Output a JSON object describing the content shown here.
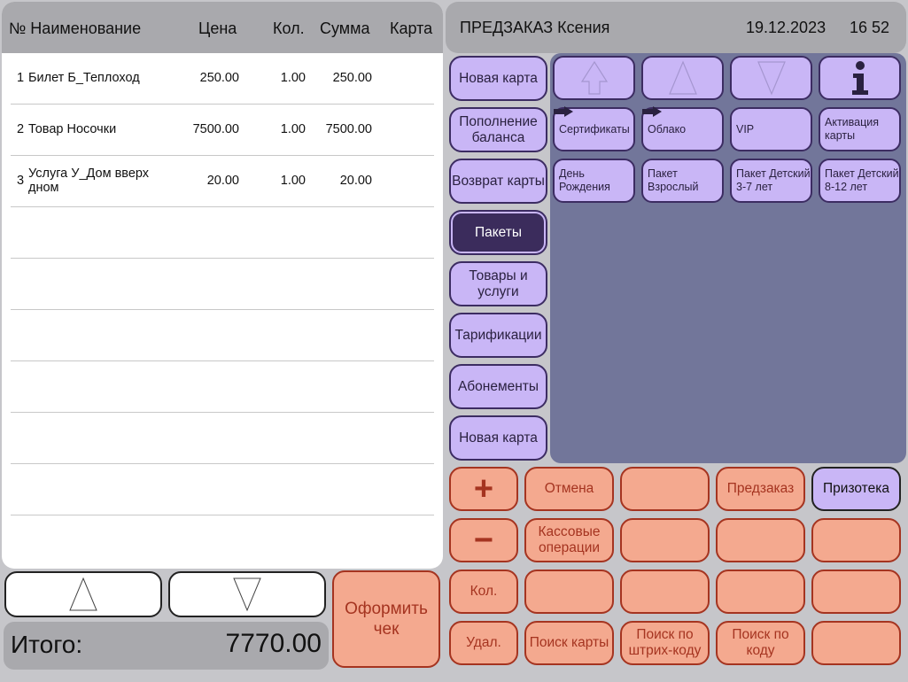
{
  "table": {
    "headers": {
      "name": "№ Наименование",
      "price": "Цена",
      "qty": "Кол.",
      "sum": "Сумма",
      "card": "Карта"
    },
    "rows": [
      {
        "num": "1",
        "name": "Билет Б_Теплоход",
        "price": "250.00",
        "qty": "1.00",
        "sum": "250.00",
        "card": ""
      },
      {
        "num": "2",
        "name": "Товар Носочки",
        "price": "7500.00",
        "qty": "1.00",
        "sum": "7500.00",
        "card": ""
      },
      {
        "num": "3",
        "name": "Услуга У_Дом вверх дном",
        "price": "20.00",
        "qty": "1.00",
        "sum": "20.00",
        "card": ""
      }
    ]
  },
  "total": {
    "label": "Итого:",
    "value": "7770.00"
  },
  "checkout_label": "Оформить чек",
  "header": {
    "title": "ПРЕДЗАКАЗ Ксения",
    "date": "19.12.2023",
    "time": "16 52"
  },
  "categories": [
    "Новая карта",
    "Пополнение баланса",
    "Возврат карты",
    "Пакеты",
    "Товары и услуги",
    "Тарификации",
    "Абонементы",
    "Новая карта"
  ],
  "active_category": "Пакеты",
  "nav_icons": [
    "arrow-up-top-icon",
    "arrow-up-icon",
    "arrow-down-icon",
    "info-icon"
  ],
  "items": [
    "Сертификаты",
    "Облако",
    "VIP",
    "Активация карты",
    "День Рождения",
    "Пакет Взрослый",
    "Пакет Детский 3-7 лет",
    "Пакет Детский 8-12 лет"
  ],
  "keypad": {
    "row1": [
      "+",
      "Отмена",
      "",
      "Предзаказ",
      "Призотека"
    ],
    "row2": [
      "−",
      "Кассовые операции",
      "",
      "",
      ""
    ],
    "row3": [
      "Кол.",
      "",
      "",
      "",
      ""
    ],
    "row4": [
      "Удал.",
      "Поиск карты",
      "Поиск по штрих-коду",
      "Поиск по коду",
      ""
    ]
  },
  "colors": {
    "accent_violet": "#c9b6f6",
    "active_violet": "#3b2c5c",
    "salmon": "#f4a98f",
    "salmon_text": "#a53420",
    "panel": "#72769a"
  }
}
